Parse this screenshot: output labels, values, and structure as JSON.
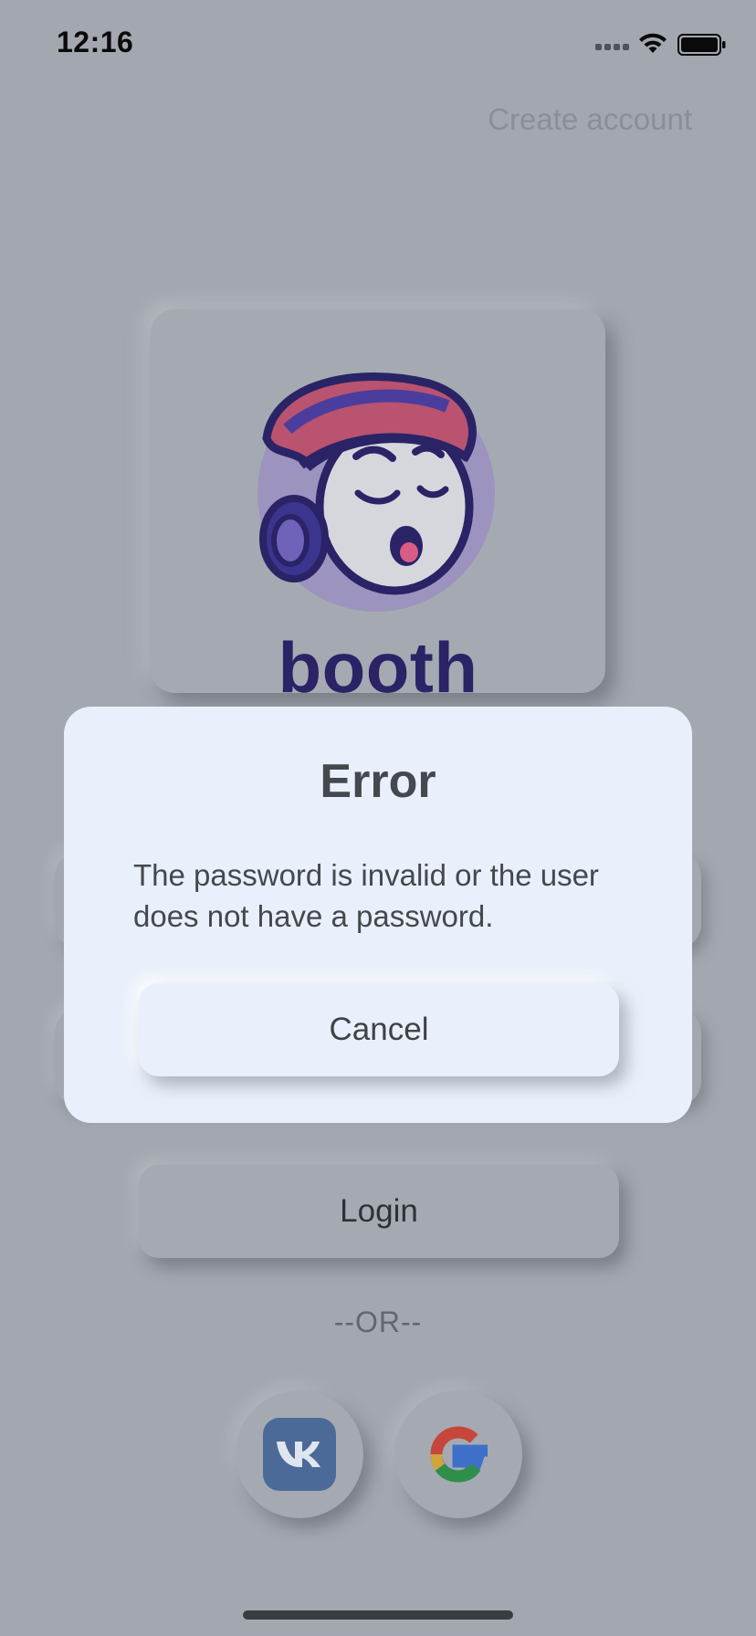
{
  "status_bar": {
    "time": "12:16"
  },
  "header": {
    "create_account_label": "Create account"
  },
  "logo": {
    "brand_name": "booth"
  },
  "login": {
    "button_label": "Login",
    "or_separator": "--OR--"
  },
  "social": {
    "vk": {
      "icon": "vk-icon",
      "color": "#4c6a97"
    },
    "google": {
      "icon": "google-icon"
    }
  },
  "dialog": {
    "title": "Error",
    "message": "The password is invalid or the user does not have a password.",
    "cancel_label": "Cancel"
  },
  "colors": {
    "background": "#a3a8b0",
    "dialog_bg": "#eaf0fb",
    "brand": "#2a2366"
  }
}
